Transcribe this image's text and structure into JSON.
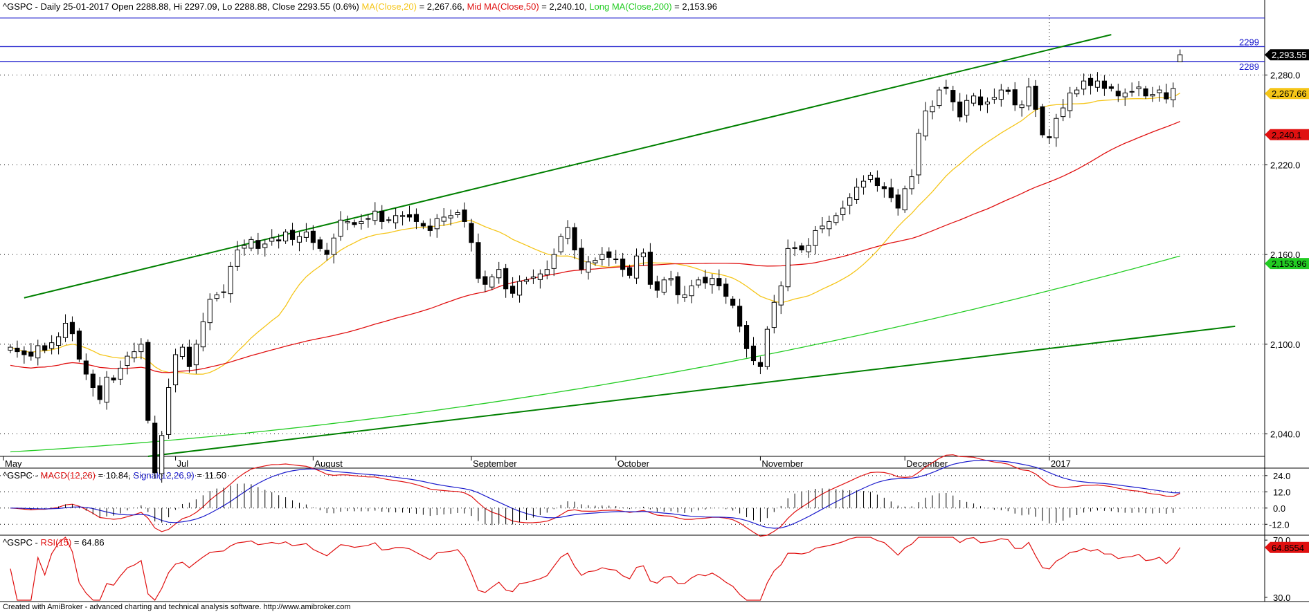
{
  "colors": {
    "candle_up": "#ffffff",
    "candle_down": "#000000",
    "ma20": "#f5c518",
    "ma50": "#e01010",
    "ma200": "#22cc22",
    "trendline": "#008000",
    "hline": "#1a1acc",
    "macd": "#e01010",
    "signal": "#1a1acc",
    "rsi": "#e01010"
  },
  "header": {
    "main": {
      "symbol_info": "^GSPC - Daily 25-01-2017 Open 2288.88, Hi 2297.09, Lo 2288.88, Close 2293.55 (0.6%)",
      "ma20_label": "MA(Close,20)",
      "ma20_value": " = 2,267.66,",
      "ma50_label": "Mid MA(Close,50)",
      "ma50_value": " = 2,240.10,",
      "ma200_label": "Long MA(Close,200)",
      "ma200_value": " = 2,153.96"
    },
    "macd": {
      "prefix": "^GSPC - ",
      "macd_label": "MACD(12,26)",
      "macd_value": " = 10.84, ",
      "signal_label": "Signal(12,26,9)",
      "signal_value": " = 11.50"
    },
    "rsi": {
      "prefix": "^GSPC - ",
      "rsi_label": "RSI(15)",
      "rsi_value": " = 64.86"
    }
  },
  "footer": "Created with AmiBroker - advanced charting and technical analysis software. http://www.amibroker.com",
  "chart_data": [
    {
      "type": "candlestick",
      "title": "^GSPC - Daily",
      "x_labels": [
        {
          "label": "May",
          "index": 0
        },
        {
          "label": "Jul",
          "index": 24
        },
        {
          "label": "August",
          "index": 44
        },
        {
          "label": "September",
          "index": 67
        },
        {
          "label": "October",
          "index": 88
        },
        {
          "label": "November",
          "index": 109
        },
        {
          "label": "December",
          "index": 130
        },
        {
          "label": "2017",
          "index": 151
        }
      ],
      "y_ticks": [
        2040,
        2100,
        2160,
        2220,
        2280
      ],
      "y_tick_labels": [
        "2,040.0",
        "2,100.0",
        "2,160.0",
        "2,220.0",
        "2,280.0"
      ],
      "ylim": [
        2025,
        2320
      ],
      "bars_total": 190,
      "last_index": 166,
      "grid": true,
      "closes": [
        2098,
        2095,
        2093,
        2092,
        2099,
        2096,
        2101,
        2105,
        2114,
        2107,
        2090,
        2080,
        2071,
        2063,
        2078,
        2076,
        2084,
        2092,
        2095,
        2100,
        2049,
        2014,
        2039,
        2071,
        2093,
        2098,
        2085,
        2100,
        2115,
        2130,
        2133,
        2135,
        2152,
        2163,
        2166,
        2170,
        2164,
        2167,
        2171,
        2169,
        2175,
        2170,
        2172,
        2175,
        2168,
        2164,
        2160,
        2171,
        2183,
        2182,
        2180,
        2182,
        2184,
        2189,
        2182,
        2183,
        2186,
        2186,
        2185,
        2182,
        2179,
        2176,
        2184,
        2185,
        2186,
        2188,
        2182,
        2168,
        2144,
        2140,
        2145,
        2150,
        2137,
        2134,
        2142,
        2143,
        2145,
        2147,
        2150,
        2160,
        2172,
        2178,
        2163,
        2150,
        2155,
        2156,
        2160,
        2158,
        2157,
        2150,
        2146,
        2159,
        2161,
        2140,
        2136,
        2143,
        2144,
        2133,
        2133,
        2139,
        2143,
        2141,
        2144,
        2139,
        2132,
        2126,
        2112,
        2097,
        2089,
        2085,
        2110,
        2128,
        2139,
        2164,
        2164,
        2163,
        2166,
        2176,
        2179,
        2182,
        2186,
        2191,
        2198,
        2205,
        2209,
        2213,
        2206,
        2204,
        2198,
        2191,
        2204,
        2212,
        2241,
        2256,
        2259,
        2270,
        2271,
        2262,
        2252,
        2263,
        2266,
        2260,
        2262,
        2265,
        2270,
        2269,
        2260,
        2260,
        2272,
        2257,
        2240,
        2238,
        2251,
        2258,
        2268,
        2270,
        2276,
        2273,
        2276,
        2271,
        2271,
        2266,
        2268,
        2269,
        2272,
        2266,
        2267,
        2270,
        2264,
        2271,
        2293.55
      ],
      "last": {
        "open": 2288.88,
        "high": 2297.09,
        "low": 2288.88,
        "close": 2293.55
      },
      "horizontal_lines": [
        {
          "value": 2299,
          "label": "2299"
        },
        {
          "value": 2289,
          "label": "2289"
        }
      ],
      "trendlines": [
        {
          "from": [
            2,
            2131
          ],
          "to": [
            160,
            2307
          ]
        },
        {
          "from": [
            20,
            2025
          ],
          "to": [
            178,
            2112
          ]
        }
      ],
      "ma20": {
        "from": [
          0,
          2087
        ],
        "to": [
          166,
          2267.66
        ]
      },
      "ma50": {
        "from": [
          0,
          2071
        ],
        "to": [
          166,
          2240.1
        ]
      },
      "ma200": {
        "from": [
          0,
          2028
        ],
        "to": [
          166,
          2153.96
        ]
      },
      "price_tags": [
        {
          "value": 2293.55,
          "label": "2,293.55",
          "bg": "#000000",
          "fg": "#ffffff"
        },
        {
          "value": 2267.66,
          "label": "2,267.66",
          "bg": "#f5c518",
          "fg": "#000000"
        },
        {
          "value": 2240.1,
          "label": "2,240.1",
          "bg": "#e01010",
          "fg": "#000000"
        },
        {
          "value": 2153.96,
          "label": "2,153.96",
          "bg": "#22cc22",
          "fg": "#000000"
        }
      ]
    },
    {
      "type": "line",
      "title": "MACD(12,26)",
      "y_ticks": [
        24,
        12,
        0,
        -12
      ],
      "y_tick_labels": [
        "24.0",
        "12.0",
        "0.0",
        "-12.0"
      ],
      "ylim": [
        -18,
        28
      ],
      "macd_last": 10.84,
      "signal_last": 11.5
    },
    {
      "type": "line",
      "title": "RSI(15)",
      "y_ticks": [
        70,
        30
      ],
      "y_tick_labels": [
        "70.0",
        "30.0"
      ],
      "ylim": [
        28,
        72
      ],
      "rsi_last": 64.86,
      "tag_label": "64.8554"
    }
  ]
}
